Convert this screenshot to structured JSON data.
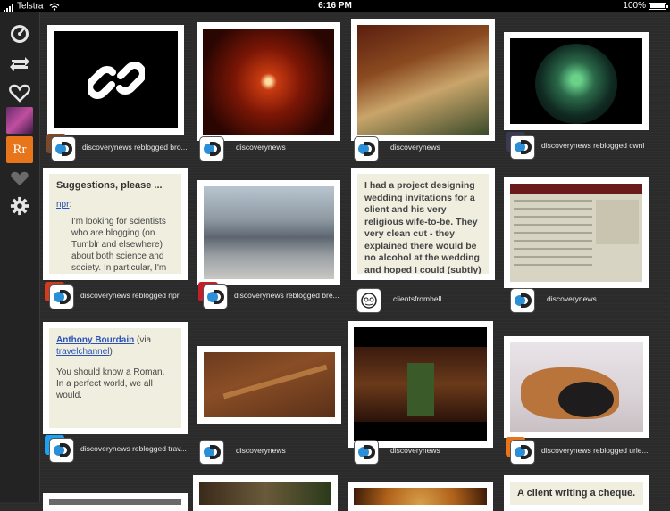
{
  "status": {
    "carrier": "Telstra",
    "time": "6:16 PM",
    "battery": "100%"
  },
  "sidebar": {
    "items": [
      {
        "name": "dashboard-icon"
      },
      {
        "name": "reblog-icon"
      },
      {
        "name": "heart-outline-icon"
      },
      {
        "name": "avatar-user"
      },
      {
        "name": "avatar-rr",
        "label": "Rr"
      },
      {
        "name": "heart-filled-icon"
      },
      {
        "name": "gear-icon"
      }
    ]
  },
  "posts": [
    {
      "meta": "discoverynews reblogged bro..."
    },
    {
      "meta": "discoverynews"
    },
    {
      "meta": "discoverynews"
    },
    {
      "meta": "discoverynews reblogged cwnl"
    },
    {
      "meta": "discoverynews reblogged npr",
      "title": "Suggestions, please ...",
      "link": "npr",
      "link_suffix": ":",
      "body": "I'm looking for scientists who are blogging (on Tumblr and elsewhere) about both science and society. In particular, I'm looking for people in the Earth sciences, such as geologists, oceanographers, climate"
    },
    {
      "meta": "discoverynews reblogged bre..."
    },
    {
      "meta": "clientsfromhell",
      "body": "I had a project designing wedding invitations for a client and his very religious wife-to-be. They very clean cut - they explained there would be no alcohol at the wedding and hoped I could (subtly) include that information in the invitation. They explained it was for moral reasons and I didn't"
    },
    {
      "meta": "discoverynews"
    },
    {
      "meta": "discoverynews reblogged trav...",
      "link1": "Anthony Bourdain",
      "mid": " (via ",
      "link2": "travelchannel",
      "end": ")",
      "body": "You should know a Roman. In a perfect world, we all would."
    },
    {
      "meta": "discoverynews"
    },
    {
      "meta": "discoverynews"
    },
    {
      "meta": "discoverynews reblogged urle..."
    },
    {
      "title": "A client writing a cheque."
    }
  ],
  "accent": {
    "rr": "#e8751a",
    "twitter": "#1da1f2",
    "discovery": "#1a6fb0"
  }
}
